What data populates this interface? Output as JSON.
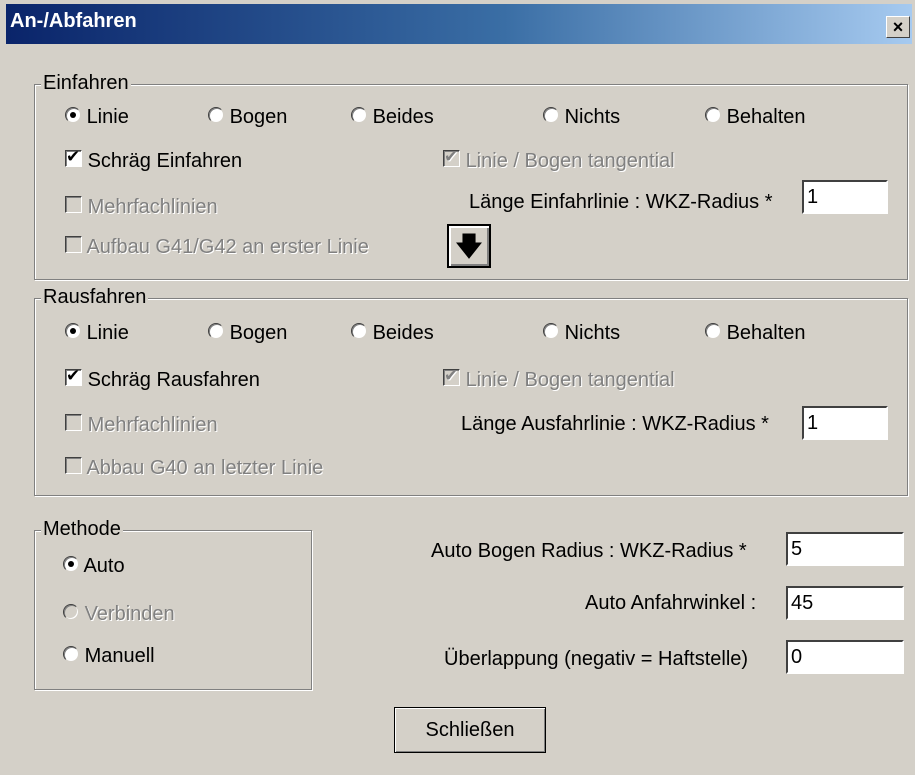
{
  "window": {
    "title": "An-/Abfahren",
    "close_glyph": "×"
  },
  "einfahren": {
    "legend": "Einfahren",
    "radios": [
      "Linie",
      "Bogen",
      "Beides",
      "Nichts",
      "Behalten"
    ],
    "selected": "Linie",
    "schraeg_label": "Schräg Einfahren",
    "schraeg_checked": true,
    "tangential_label": "Linie / Bogen tangential",
    "tangential_checked": true,
    "mehrfach_label": "Mehrfachlinien",
    "aufbau_label": "Aufbau G41/G42 an erster Linie",
    "laenge_label": "Länge Einfahrlinie : WKZ-Radius *",
    "laenge_value": "1",
    "arrow_icon": "arrow-down-icon"
  },
  "rausfahren": {
    "legend": "Rausfahren",
    "radios": [
      "Linie",
      "Bogen",
      "Beides",
      "Nichts",
      "Behalten"
    ],
    "selected": "Linie",
    "schraeg_label": "Schräg Rausfahren",
    "schraeg_checked": true,
    "tangential_label": "Linie / Bogen tangential",
    "tangential_checked": true,
    "mehrfach_label": "Mehrfachlinien",
    "abbau_label": "Abbau G40 an letzter Linie",
    "laenge_label": "Länge Ausfahrlinie : WKZ-Radius *",
    "laenge_value": "1"
  },
  "methode": {
    "legend": "Methode",
    "options": [
      "Auto",
      "Verbinden",
      "Manuell"
    ],
    "selected": "Auto"
  },
  "auto": {
    "radius_label": "Auto Bogen Radius : WKZ-Radius *",
    "radius_value": "5",
    "winkel_label": "Auto Anfahrwinkel :",
    "winkel_value": "45",
    "ueberlappung_label": "Überlappung (negativ = Haftstelle)",
    "ueberlappung_value": "0"
  },
  "close_button": "Schließen",
  "colors": {
    "titlebar_start": "#0a246a",
    "titlebar_end": "#a6caf0",
    "face": "#d4d0c8"
  }
}
